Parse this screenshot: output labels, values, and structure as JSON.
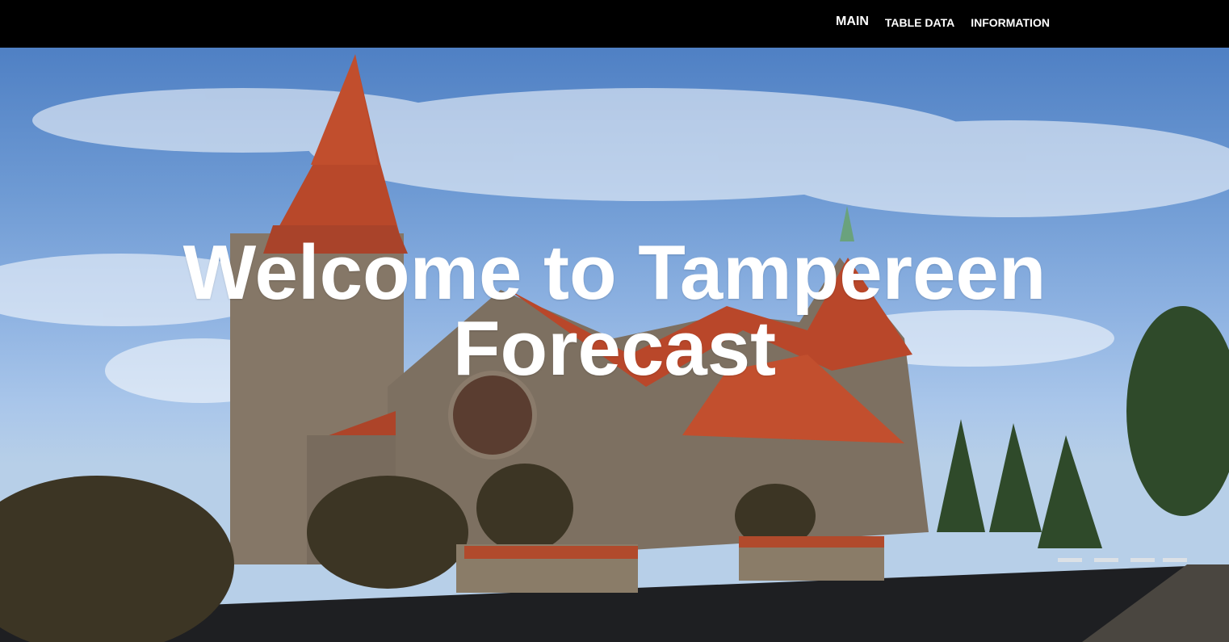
{
  "nav": {
    "items": [
      {
        "label": "MAIN",
        "active": true
      },
      {
        "label": "TABLE DATA",
        "active": false
      },
      {
        "label": "INFORMATION",
        "active": false
      }
    ]
  },
  "hero": {
    "title": "Welcome to Tampereen Forecast"
  }
}
